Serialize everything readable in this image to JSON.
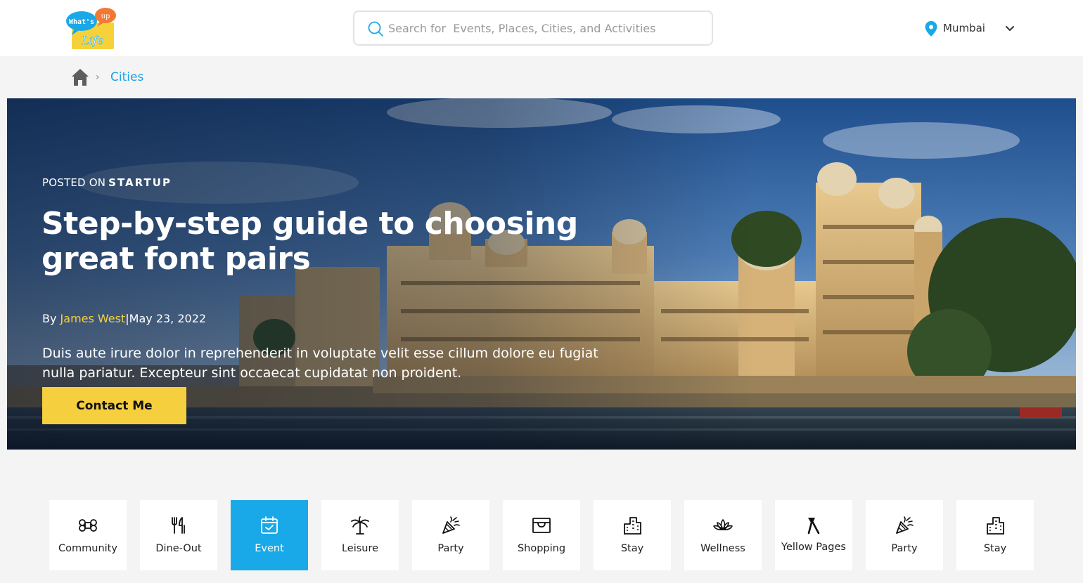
{
  "header": {
    "logo": {
      "top_text": "up",
      "middle_text": "What's",
      "bottom_text": "Life"
    },
    "search": {
      "placeholder": "Search for  Events, Places, Cities, and Activities",
      "value": ""
    },
    "location": {
      "city": "Mumbai"
    }
  },
  "breadcrumb": {
    "items": [
      "Cities"
    ]
  },
  "hero": {
    "posted_prefix": "POSTED ON",
    "posted_category": "STARTUP",
    "title": "Step-by-step guide to choosing great font pairs",
    "by_prefix": "By",
    "author": "James West",
    "date_sep": "|",
    "date": "May 23, 2022",
    "description": "Duis aute irure dolor in reprehenderit in voluptate velit esse cillum dolore eu fugiat nulla pariatur. Excepteur sint occaecat cupidatat non proident.",
    "cta_label": "Contact Me"
  },
  "categories": [
    {
      "label": "Community",
      "icon": "command-icon",
      "active": false
    },
    {
      "label": "Dine-Out",
      "icon": "fork-knife-icon",
      "active": false
    },
    {
      "label": "Event",
      "icon": "calendar-check-icon",
      "active": true
    },
    {
      "label": "Leisure",
      "icon": "palm-tree-icon",
      "active": false
    },
    {
      "label": "Party",
      "icon": "party-popper-icon",
      "active": false
    },
    {
      "label": "Shopping",
      "icon": "shopping-box-icon",
      "active": false
    },
    {
      "label": "Stay",
      "icon": "building-icon",
      "active": false
    },
    {
      "label": "Wellness",
      "icon": "lotus-icon",
      "active": false
    },
    {
      "label": "Yellow Pages",
      "icon": "yellow-pages-icon",
      "active": false
    },
    {
      "label": "Party",
      "icon": "party-popper-icon",
      "active": false
    },
    {
      "label": "Stay",
      "icon": "building-icon",
      "active": false
    }
  ],
  "colors": {
    "accent": "#1aa9e8",
    "cta": "#f6cf3f",
    "author": "#f6cf3f",
    "breadcrumb_link": "#1da1e6"
  }
}
